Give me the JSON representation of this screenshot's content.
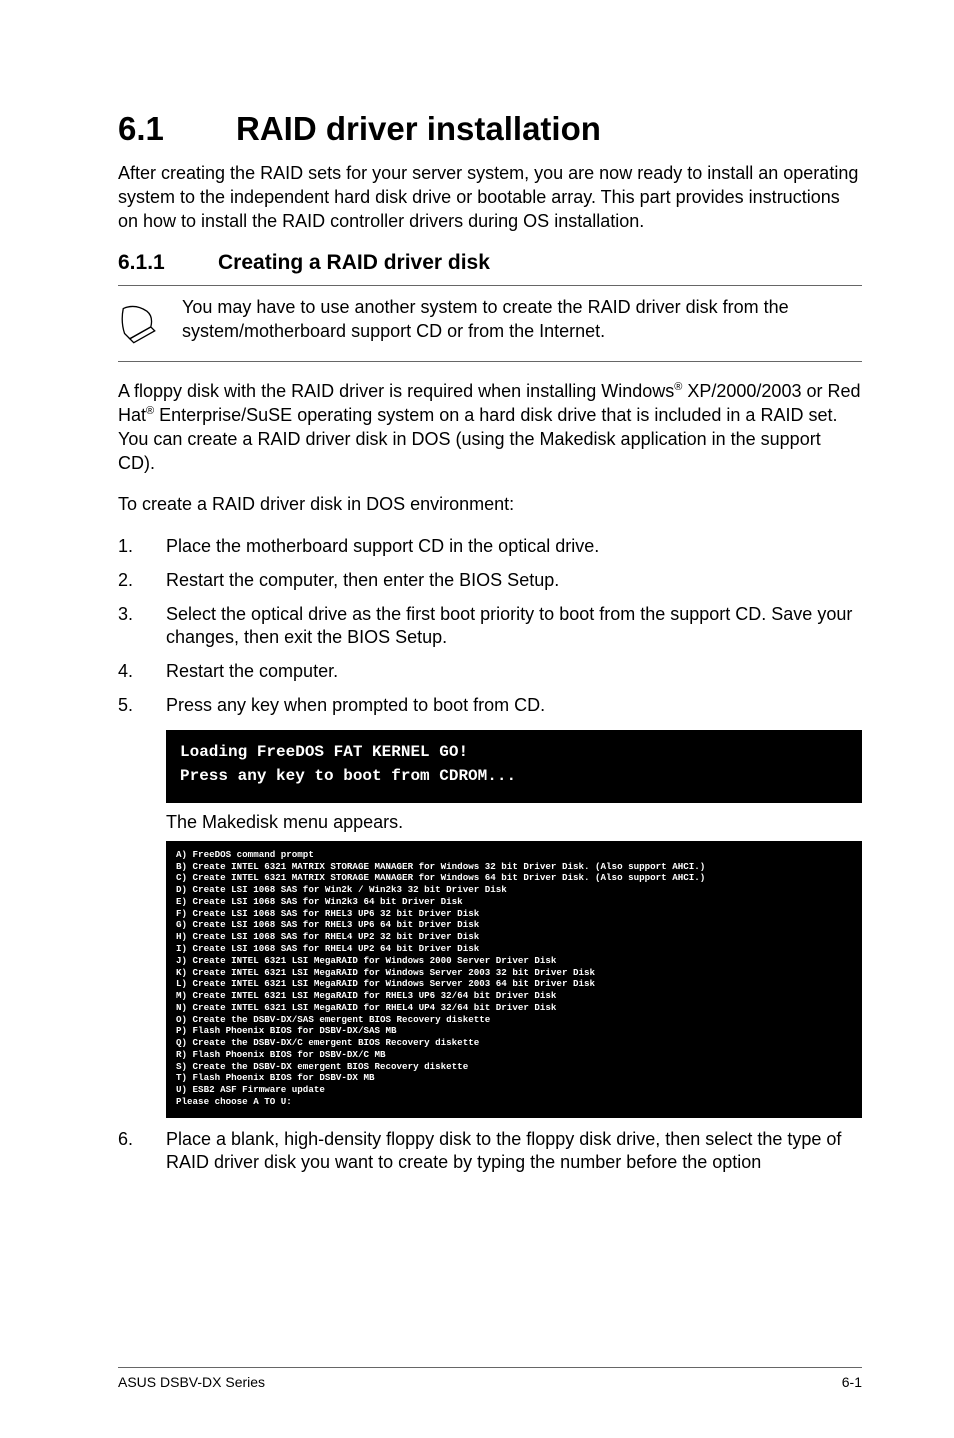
{
  "title": {
    "num": "6.1",
    "text": "RAID driver installation"
  },
  "intro": "After creating the RAID sets for your server system, you are now ready to install an operating system to the independent hard disk drive or bootable array. This part provides instructions on how to install the RAID controller drivers during OS installation.",
  "subsection": {
    "num": "6.1.1",
    "text": "Creating a RAID driver disk"
  },
  "note": "You may have to use another system to create the RAID driver disk from the system/motherboard support CD or from the Internet.",
  "para2_a": "A floppy disk with the RAID driver is required when installing Windows",
  "para2_reg1": "®",
  "para2_b": " XP/2000/2003 or Red Hat",
  "para2_reg2": "®",
  "para2_c": " Enterprise/SuSE operating system on a hard disk drive that is included in a RAID set. You can create a RAID driver disk in DOS (using the Makedisk application in the support CD).",
  "para3": "To create a RAID driver disk in DOS environment:",
  "steps": [
    {
      "n": "1.",
      "t": "Place the motherboard support CD in the optical drive."
    },
    {
      "n": "2.",
      "t": "Restart the computer, then enter the BIOS Setup."
    },
    {
      "n": "3.",
      "t": "Select the optical drive as the first boot priority to boot from the support CD. Save your changes, then exit the BIOS Setup."
    },
    {
      "n": "4.",
      "t": "Restart the computer."
    },
    {
      "n": "5.",
      "t": "Press any key when prompted to boot from CD."
    }
  ],
  "term1_l1": "Loading FreeDOS FAT KERNEL GO!",
  "term1_l2": "Press any key to boot from CDROM...",
  "caption1": "The Makedisk menu appears.",
  "menu": [
    "A)   FreeDOS command prompt",
    "B)   Create INTEL 6321 MATRIX STORAGE MANAGER for Windows 32 bit Driver Disk. (Also support AHCI.)",
    "C)   Create INTEL 6321 MATRIX STORAGE MANAGER for Windows 64 bit Driver Disk. (Also support AHCI.)",
    "D)   Create LSI 1068 SAS for Win2k / Win2k3 32 bit Driver Disk",
    "E)   Create LSI 1068 SAS for Win2k3 64 bit Driver Disk",
    "F)   Create LSI 1068 SAS for RHEL3 UP6 32 bit Driver Disk",
    "G)   Create LSI 1068 SAS for RHEL3 UP6 64 bit Driver Disk",
    "H)   Create LSI 1068 SAS for RHEL4 UP2 32 bit Driver Disk",
    "I)   Create LSI 1068 SAS for RHEL4 UP2 64 bit Driver Disk",
    "J)   Create INTEL 6321 LSI MegaRAID for Windows 2000 Server Driver Disk",
    "K)   Create INTEL 6321 LSI MegaRAID for Windows Server 2003 32 bit Driver Disk",
    "L)   Create INTEL 6321 LSI MegaRAID for Windows Server 2003 64 bit Driver Disk",
    "M)   Create INTEL 6321 LSI MegaRAID for RHEL3 UP6 32/64 bit Driver Disk",
    "N)   Create INTEL 6321 LSI MegaRAID for RHEL4 UP4 32/64 bit Driver Disk",
    "O)   Create the DSBV-DX/SAS emergent BIOS Recovery diskette",
    "P)   Flash Phoenix BIOS for DSBV-DX/SAS MB",
    "Q)   Create the DSBV-DX/C emergent BIOS Recovery diskette",
    "R)   Flash Phoenix BIOS for DSBV-DX/C MB",
    "S)   Create the DSBV-DX emergent BIOS Recovery diskette",
    "T)   Flash Phoenix BIOS for DSBV-DX MB",
    "U)   ESB2 ASF Firmware update",
    "",
    "Please choose A TO U:"
  ],
  "step6": {
    "n": "6.",
    "t": "Place a blank, high-density floppy disk to the floppy disk drive, then select the type of RAID driver disk you want to create by typing the number before the option"
  },
  "footer_left": "ASUS DSBV-DX Series",
  "footer_right": "6-1"
}
